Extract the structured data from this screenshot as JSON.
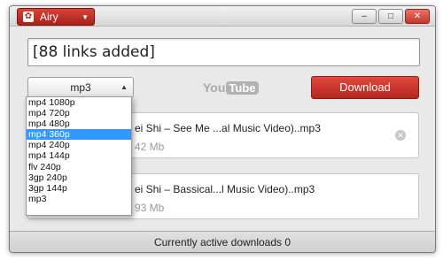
{
  "app": {
    "title": "Airy",
    "logo_icon": "airy-logo-icon"
  },
  "window_controls": {
    "minimize": "‒",
    "maximize": "□",
    "close": "✕"
  },
  "url_input": {
    "value": "[88 links added]"
  },
  "format": {
    "selected": "mp3",
    "options": [
      "mp4 1080p",
      "mp4 720p",
      "mp4 480p",
      "mp4 360p",
      "mp4 240p",
      "mp4 144p",
      "flv 240p",
      "3gp 240p",
      "3gp 144p",
      "mp3"
    ],
    "highlighted_index": 3
  },
  "youtube": {
    "you": "You",
    "tube": "Tube"
  },
  "download_button": {
    "label": "Download"
  },
  "downloads": [
    {
      "title": "ei Shi –  See Me  ...al Music Video)..mp3",
      "size": "42 Mb"
    },
    {
      "title": "ei Shi –  Bassical...l Music Video)..mp3",
      "size": "93 Mb"
    }
  ],
  "status": {
    "text": "Currently active downloads 0"
  },
  "colors": {
    "accent_red": "#c5342b",
    "selection_blue": "#3399ff"
  }
}
